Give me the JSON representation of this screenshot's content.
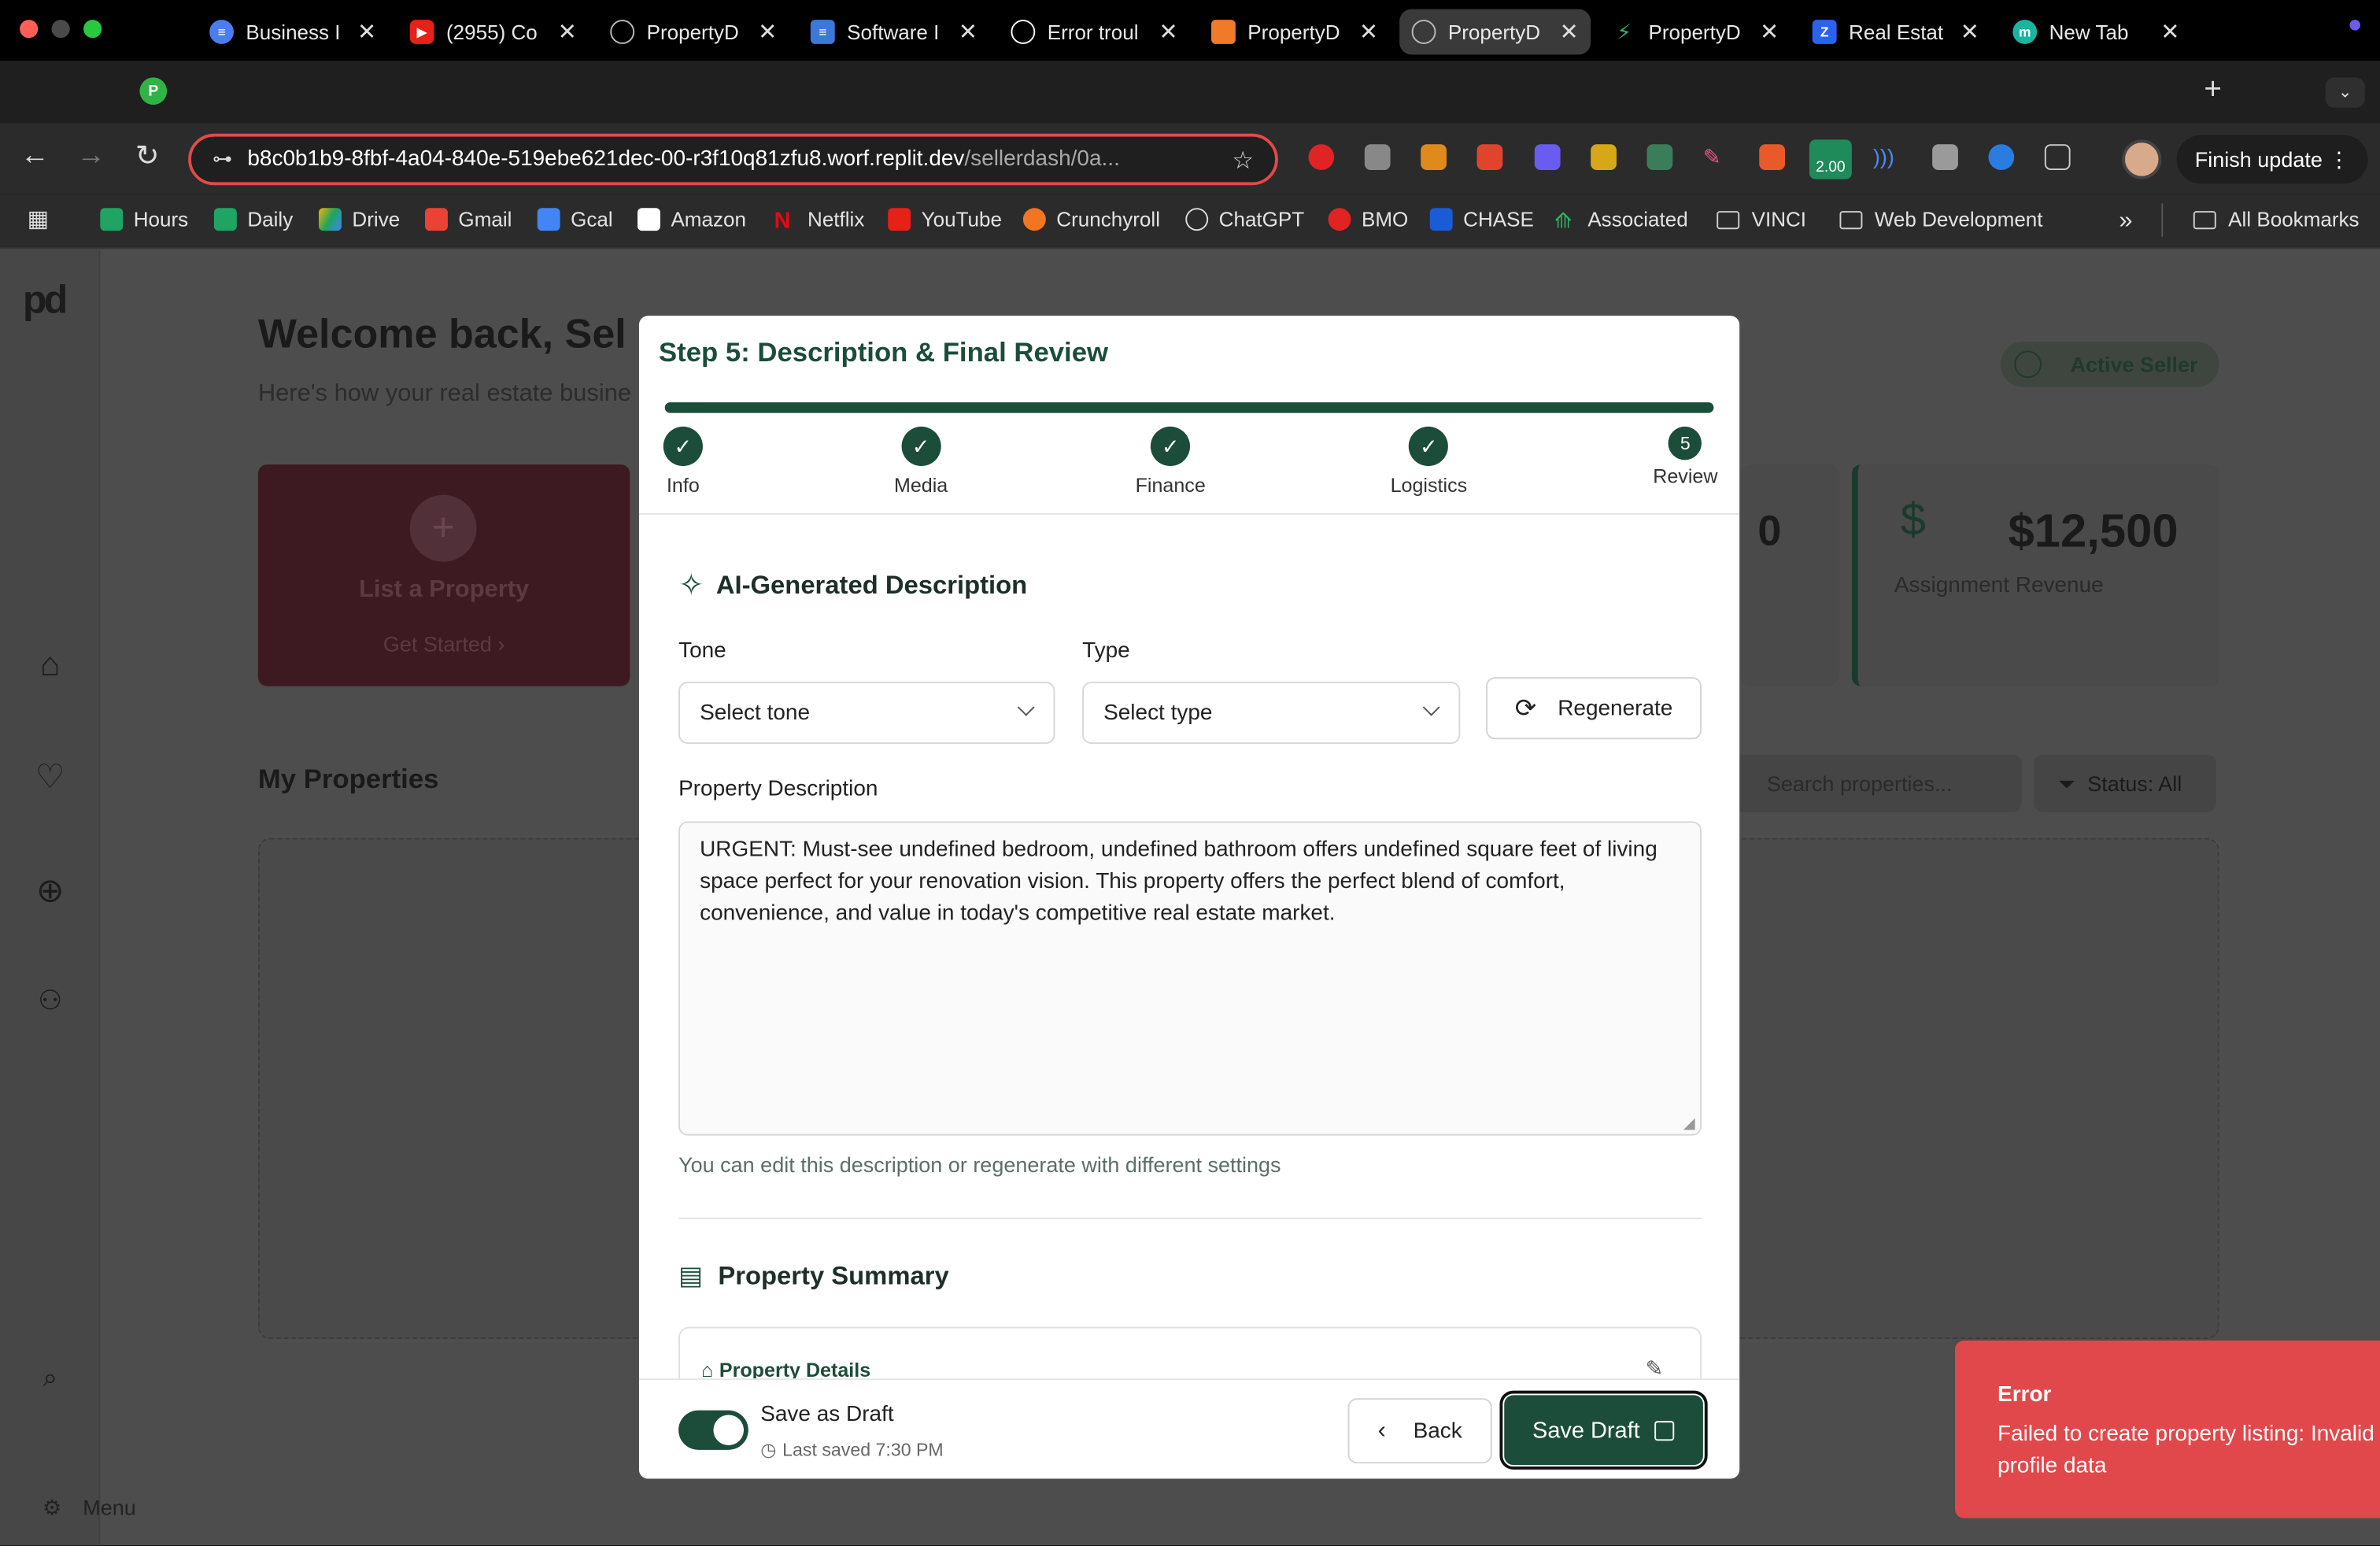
{
  "browser": {
    "tabs": [
      {
        "title": "P",
        "label": "",
        "active": false,
        "color": "#2fb344"
      },
      {
        "title": "Business I",
        "active": false,
        "color": "#4a7df0"
      },
      {
        "title": "(2955) Co",
        "active": false,
        "color": "#e62117"
      },
      {
        "title": "PropertyD",
        "active": false,
        "color": "#8a8a8a"
      },
      {
        "title": "Software I",
        "active": false,
        "color": "#3c78d8"
      },
      {
        "title": "Error troul",
        "active": false,
        "color": "#ffffff"
      },
      {
        "title": "PropertyD",
        "active": false,
        "color": "#f07a2a"
      },
      {
        "title": "PropertyD",
        "active": true,
        "color": "#8a8a8a"
      },
      {
        "title": "PropertyD",
        "active": false,
        "color": "#2fb366"
      },
      {
        "title": "Real Estat",
        "active": false,
        "color": "#2a62f0"
      },
      {
        "title": "New Tab",
        "active": false,
        "color": "#18b6a0"
      }
    ],
    "url_host": "b8c0b1b9-8fbf-4a04-840e-519ebe621dec-00-r3f10q81zfu8.worf.replit.dev",
    "url_path": "/sellerdash/0a...",
    "finish_update": "Finish update",
    "ext_badge": "2.00",
    "bookmarks": [
      "Hours",
      "Daily",
      "Drive",
      "Gmail",
      "Gcal",
      "Amazon",
      "Netflix",
      "YouTube",
      "Crunchyroll",
      "ChatGPT",
      "BMO",
      "CHASE",
      "Associated",
      "VINCI",
      "Web Development"
    ],
    "all_bookmarks": "All Bookmarks",
    "more": "»"
  },
  "app": {
    "logo": "pd",
    "welcome": "Welcome back, Sel",
    "welcome_sub": "Here's how your real estate busine",
    "active_seller": "Active Seller",
    "list_property": "List a Property",
    "get_started": "Get Started",
    "stat_count": "0",
    "revenue_value": "$12,500",
    "revenue_label": "Assignment Revenue",
    "my_properties": "My Properties",
    "search_placeholder": "Search properties...",
    "status_filter": "Status: All",
    "menu": "Menu"
  },
  "modal": {
    "title": "Step 5: Description & Final Review",
    "progress_percent": 100,
    "steps": [
      {
        "label": "Info",
        "state": "done"
      },
      {
        "label": "Media",
        "state": "done"
      },
      {
        "label": "Finance",
        "state": "done"
      },
      {
        "label": "Logistics",
        "state": "done"
      },
      {
        "label": "Review",
        "state": "current",
        "number": "5"
      }
    ],
    "ai_title": "AI-Generated Description",
    "tone_label": "Tone",
    "tone_value": "Select tone",
    "type_label": "Type",
    "type_value": "Select type",
    "regenerate": "Regenerate",
    "desc_label": "Property Description",
    "description": "URGENT: Must-see undefined bedroom, undefined bathroom  offers undefined square feet of living space perfect for your renovation vision. This property offers the perfect blend of comfort, convenience, and value in today's competitive real estate market.",
    "hint": "You can edit this description or regenerate with different settings",
    "summary_title": "Property Summary",
    "details_title": "Property Details",
    "save_as_draft": "Save as Draft",
    "save_as_draft_on": true,
    "last_saved": "Last saved 7:30 PM",
    "back": "Back",
    "save_draft": "Save Draft"
  },
  "toast": {
    "title": "Error",
    "message": "Failed to create property listing: Invalid p profile data"
  },
  "colors": {
    "brand": "#1b4d3a",
    "error": "#e0484b",
    "accent_red": "#e04b49"
  }
}
